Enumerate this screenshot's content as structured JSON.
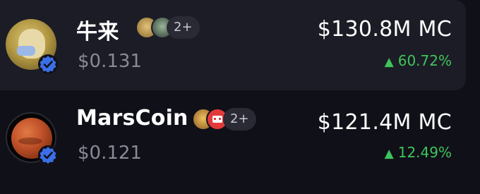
{
  "tokens": [
    {
      "name": "牛来",
      "price": "$0.131",
      "market_cap": "$130.8M MC",
      "change": "60.72%",
      "holders_more": "2+",
      "avatar_icon": "shiba-dog-avatar-icon",
      "verified_icon": "verified-badge-icon"
    },
    {
      "name": "MarsCoin",
      "price": "$0.121",
      "market_cap": "$121.4M MC",
      "change": "12.49%",
      "holders_more": "2+",
      "avatar_icon": "mars-planet-avatar-icon",
      "verified_icon": "verified-badge-icon"
    }
  ],
  "colors": {
    "background": "#101019",
    "highlight_row": "#1c1c26",
    "positive": "#3ec45a",
    "muted_text": "#8a8a96",
    "verified_badge": "#3b6fe6"
  }
}
